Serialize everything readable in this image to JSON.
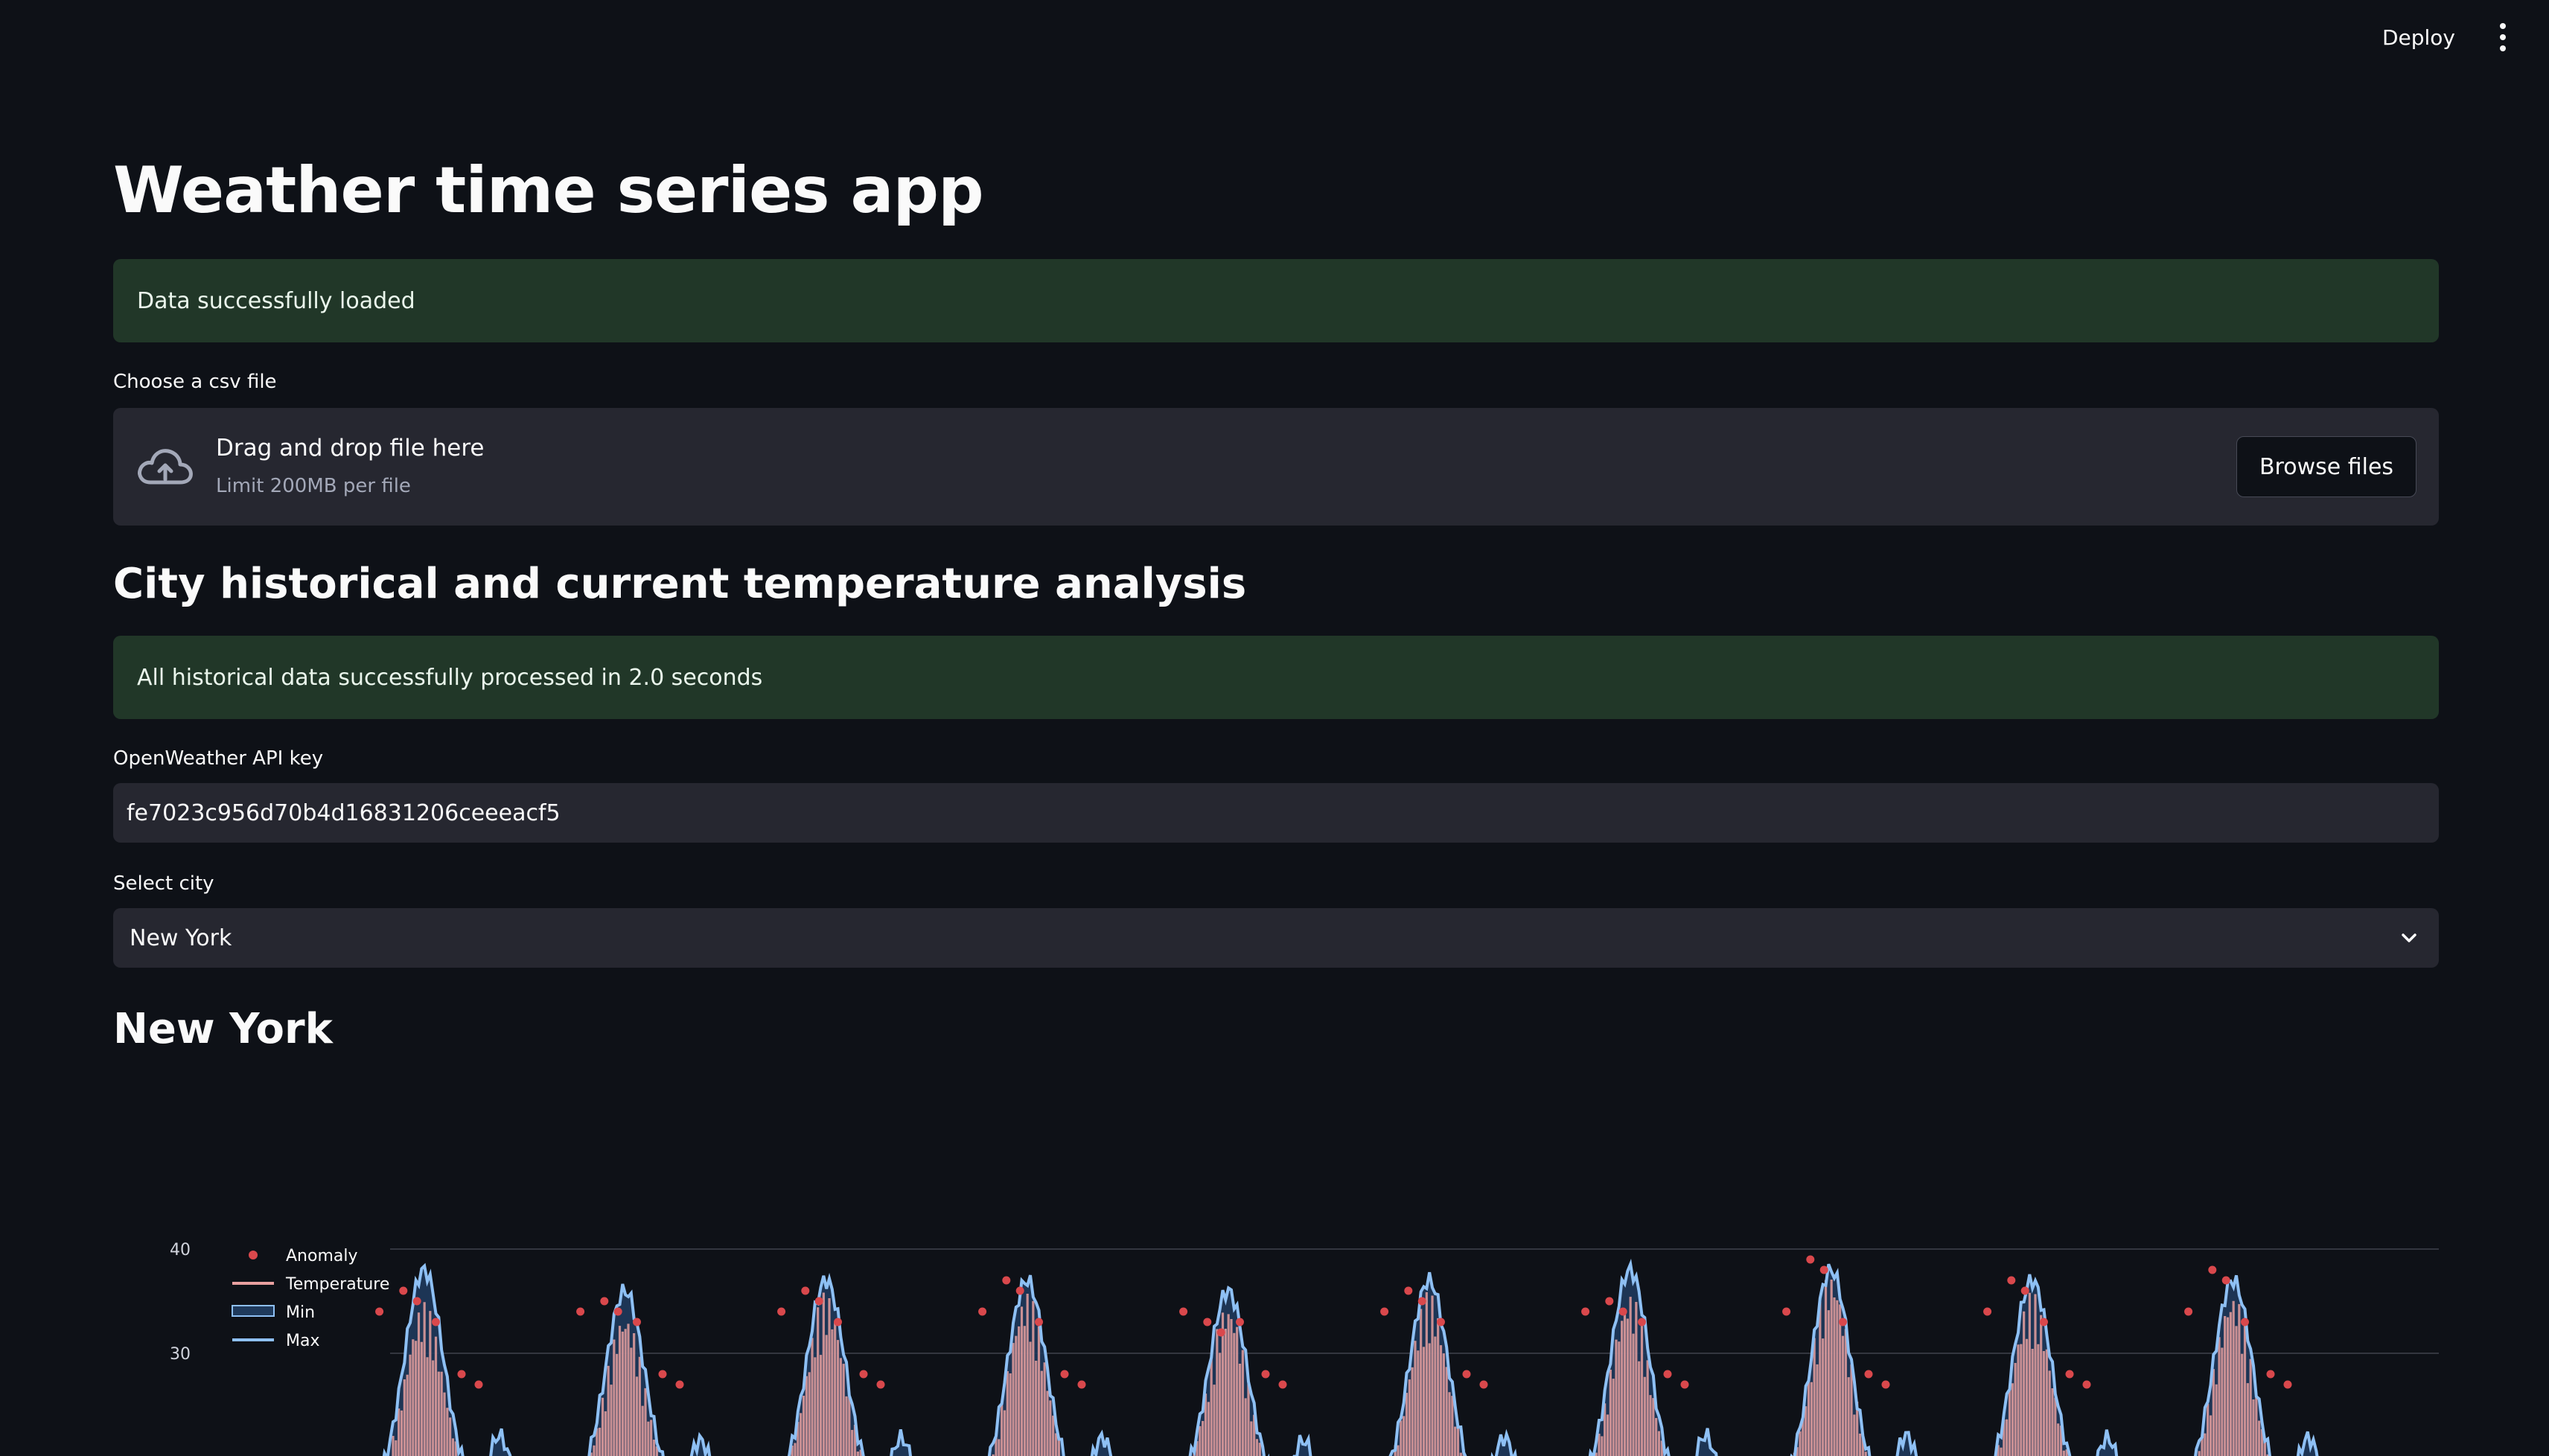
{
  "toolbar": {
    "deploy_label": "Deploy",
    "menu_icon": "more-vertical-icon"
  },
  "page": {
    "title": "Weather time series app"
  },
  "alerts": {
    "data_loaded": "Data successfully loaded",
    "historical_processed": "All historical data successfully processed in 2.0 seconds"
  },
  "uploader": {
    "label": "Choose a csv file",
    "icon": "cloud-upload-icon",
    "drop_text": "Drag and drop file here",
    "limit_text": "Limit 200MB per file",
    "browse_label": "Browse files"
  },
  "section": {
    "heading": "City historical and current temperature analysis"
  },
  "api_key": {
    "label": "OpenWeather API key",
    "value": "fe7023c956d70b4d16831206ceeeacf5"
  },
  "city_select": {
    "label": "Select city",
    "selected": "New York",
    "icon": "chevron-down-icon"
  },
  "city_heading": "New York",
  "colors": {
    "background": "#0e1117",
    "success_bg": "#213728",
    "input_bg": "#262730",
    "temperature": "#e8a0a0",
    "band": "#1f3a5c",
    "max_line": "#8ec0f4",
    "anomaly": "#d9484c"
  },
  "chart_data": {
    "type": "line",
    "legend_position": "top-left",
    "legend": [
      {
        "name": "Anomaly",
        "color": "#d9484c"
      },
      {
        "name": "Temperature",
        "color": "#e8a0a0"
      },
      {
        "name": "Min",
        "color": "#1f3a5c"
      },
      {
        "name": "Max",
        "color": "#8ec0f4"
      }
    ],
    "y_ticks": [
      "40",
      "30"
    ],
    "ylim": [
      17,
      43
    ],
    "grid": true,
    "season_count": 10,
    "series": [
      {
        "name": "Max",
        "note_values": [
          38,
          36,
          37,
          37,
          36,
          37,
          38,
          38,
          37,
          37
        ]
      },
      {
        "name": "Temperature",
        "note_values": [
          35,
          34,
          36,
          36,
          35,
          36,
          36,
          38,
          36,
          36
        ]
      }
    ],
    "anomaly_peaks": [
      36,
      35,
      36,
      37,
      33,
      36,
      35,
      39,
      37,
      38
    ]
  }
}
